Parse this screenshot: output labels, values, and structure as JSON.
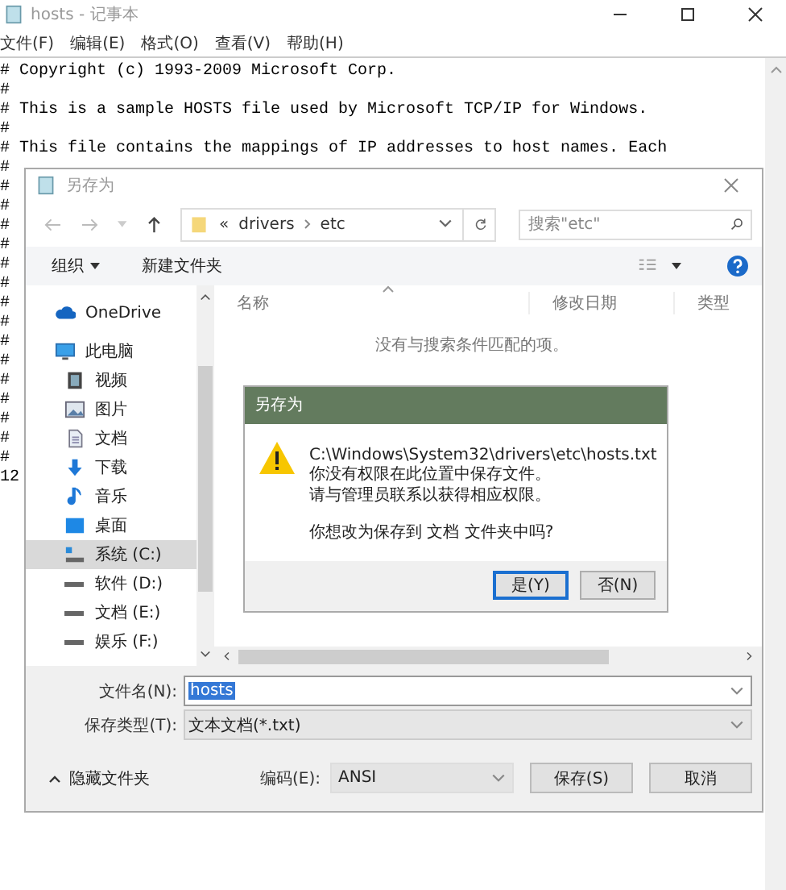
{
  "notepad": {
    "title": "hosts - 记事本",
    "menu": [
      "文件(F)",
      "编辑(E)",
      "格式(O)",
      "查看(V)",
      "帮助(H)"
    ],
    "lines": [
      "# Copyright (c) 1993-2009 Microsoft Corp.",
      "#",
      "# This is a sample HOSTS file used by Microsoft TCP/IP for Windows.",
      "#",
      "# This file contains the mappings of IP addresses to host names. Each",
      "#",
      "#",
      "#",
      "#",
      "#",
      "#",
      "#",
      "#",
      "#",
      "#",
      "#",
      "#",
      "#",
      "#",
      "#",
      "#",
      "12"
    ]
  },
  "save_dialog": {
    "title": "另存为",
    "path": [
      "«",
      "drivers",
      "etc"
    ],
    "search": {
      "placeholder": "搜索\"etc\""
    },
    "toolbar": [
      "组织",
      "新建文件夹"
    ],
    "sidebar": [
      {
        "label": "OneDrive",
        "kind": "cloud",
        "selected": false
      },
      {
        "label": "此电脑",
        "kind": "pc",
        "selected": false,
        "children": [
          {
            "label": "视频",
            "kind": "video",
            "selected": false
          },
          {
            "label": "图片",
            "kind": "picture",
            "selected": false
          },
          {
            "label": "文档",
            "kind": "document",
            "selected": false
          },
          {
            "label": "下载",
            "kind": "download",
            "selected": false
          },
          {
            "label": "音乐",
            "kind": "music",
            "selected": false
          },
          {
            "label": "桌面",
            "kind": "desktop",
            "selected": false
          },
          {
            "label": "系统 (C:)",
            "kind": "system-drive",
            "selected": true
          },
          {
            "label": "软件 (D:)",
            "kind": "drive",
            "selected": false
          },
          {
            "label": "文档 (E:)",
            "kind": "drive",
            "selected": false
          },
          {
            "label": "娱乐 (F:)",
            "kind": "drive",
            "selected": false
          }
        ]
      }
    ],
    "columns": [
      "名称",
      "修改日期",
      "类型"
    ],
    "empty_message": "没有与搜索条件匹配的项。",
    "file_name": {
      "label": "文件名(N):",
      "value": "hosts"
    },
    "file_type": {
      "label": "保存类型(T):",
      "value": "文本文档(*.txt)"
    },
    "hide_folders": "隐藏文件夹",
    "encoding": {
      "label": "编码(E):",
      "value": "ANSI"
    },
    "buttons": [
      "保存(S)",
      "取消"
    ]
  },
  "alert": {
    "title": "另存为",
    "lines": [
      "C:\\Windows\\System32\\drivers\\etc\\hosts.txt",
      "你没有权限在此位置中保存文件。",
      "请与管理员联系以获得相应权限。"
    ],
    "question": "你想改为保存到 文档 文件夹中吗?",
    "buttons": [
      {
        "label": "是(Y)",
        "default": true
      },
      {
        "label": "否(N)",
        "default": false
      }
    ]
  }
}
